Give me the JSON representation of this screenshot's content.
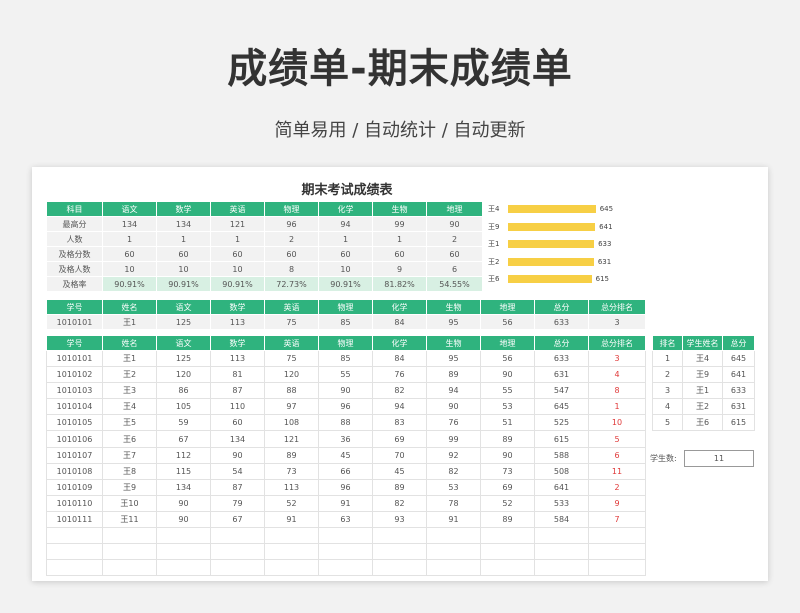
{
  "hero": {
    "title": "成绩单-期末成绩单",
    "subtitle": "简单易用 / 自动统计 / 自动更新"
  },
  "sheet": {
    "title": "期末考试成绩表",
    "stats": {
      "headers": [
        "科目",
        "语文",
        "数学",
        "英语",
        "物理",
        "化学",
        "生物",
        "地理"
      ],
      "rows": [
        {
          "label": "最高分",
          "values": [
            "134",
            "134",
            "121",
            "96",
            "94",
            "99",
            "90"
          ]
        },
        {
          "label": "人数",
          "values": [
            "1",
            "1",
            "1",
            "2",
            "1",
            "1",
            "2"
          ]
        },
        {
          "label": "及格分数",
          "values": [
            "60",
            "60",
            "60",
            "60",
            "60",
            "60",
            "60"
          ]
        },
        {
          "label": "及格人数",
          "values": [
            "10",
            "10",
            "10",
            "8",
            "10",
            "9",
            "6"
          ]
        },
        {
          "label": "及格率",
          "values": [
            "90.91%",
            "90.91%",
            "90.91%",
            "72.73%",
            "90.91%",
            "81.82%",
            "54.55%"
          ]
        }
      ]
    },
    "lookup": {
      "headers": [
        "学号",
        "姓名",
        "语文",
        "数学",
        "英语",
        "物理",
        "化学",
        "生物",
        "地理",
        "总分",
        "总分排名"
      ],
      "row": [
        "1010101",
        "王1",
        "125",
        "113",
        "75",
        "85",
        "84",
        "95",
        "56",
        "633",
        "3"
      ]
    },
    "grades": {
      "headers": [
        "学号",
        "姓名",
        "语文",
        "数学",
        "英语",
        "物理",
        "化学",
        "生物",
        "地理",
        "总分",
        "总分排名"
      ],
      "rows": [
        [
          "1010101",
          "王1",
          "125",
          "113",
          "75",
          "85",
          "84",
          "95",
          "56",
          "633",
          "3"
        ],
        [
          "1010102",
          "王2",
          "120",
          "81",
          "120",
          "55",
          "76",
          "89",
          "90",
          "631",
          "4"
        ],
        [
          "1010103",
          "王3",
          "86",
          "87",
          "88",
          "90",
          "82",
          "94",
          "55",
          "547",
          "8"
        ],
        [
          "1010104",
          "王4",
          "105",
          "110",
          "97",
          "96",
          "94",
          "90",
          "53",
          "645",
          "1"
        ],
        [
          "1010105",
          "王5",
          "59",
          "60",
          "108",
          "88",
          "83",
          "76",
          "51",
          "525",
          "10"
        ],
        [
          "1010106",
          "王6",
          "67",
          "134",
          "121",
          "36",
          "69",
          "99",
          "89",
          "615",
          "5"
        ],
        [
          "1010107",
          "王7",
          "112",
          "90",
          "89",
          "45",
          "70",
          "92",
          "90",
          "588",
          "6"
        ],
        [
          "1010108",
          "王8",
          "115",
          "54",
          "73",
          "66",
          "45",
          "82",
          "73",
          "508",
          "11"
        ],
        [
          "1010109",
          "王9",
          "134",
          "87",
          "113",
          "96",
          "89",
          "53",
          "69",
          "641",
          "2"
        ],
        [
          "1010110",
          "王10",
          "90",
          "79",
          "52",
          "91",
          "82",
          "78",
          "52",
          "533",
          "9"
        ],
        [
          "1010111",
          "王11",
          "90",
          "67",
          "91",
          "63",
          "93",
          "91",
          "89",
          "584",
          "7"
        ]
      ],
      "empty_rows": 3
    },
    "top5": {
      "headers": [
        "排名",
        "学生姓名",
        "总分"
      ],
      "rows": [
        [
          "1",
          "王4",
          "645"
        ],
        [
          "2",
          "王9",
          "641"
        ],
        [
          "3",
          "王1",
          "633"
        ],
        [
          "4",
          "王2",
          "631"
        ],
        [
          "5",
          "王6",
          "615"
        ]
      ]
    },
    "student_count": {
      "label": "学生数:",
      "value": "11"
    }
  },
  "chart_data": {
    "type": "bar",
    "orientation": "horizontal",
    "categories": [
      "王4",
      "王9",
      "王1",
      "王2",
      "王6"
    ],
    "values": [
      645,
      641,
      633,
      631,
      615
    ],
    "xlim": [
      0,
      1000
    ],
    "color": "#f7cf45"
  },
  "colors": {
    "header": "#2fb37e",
    "rank_text": "#e03a3a",
    "rate_bg": "#d8f0e3"
  }
}
